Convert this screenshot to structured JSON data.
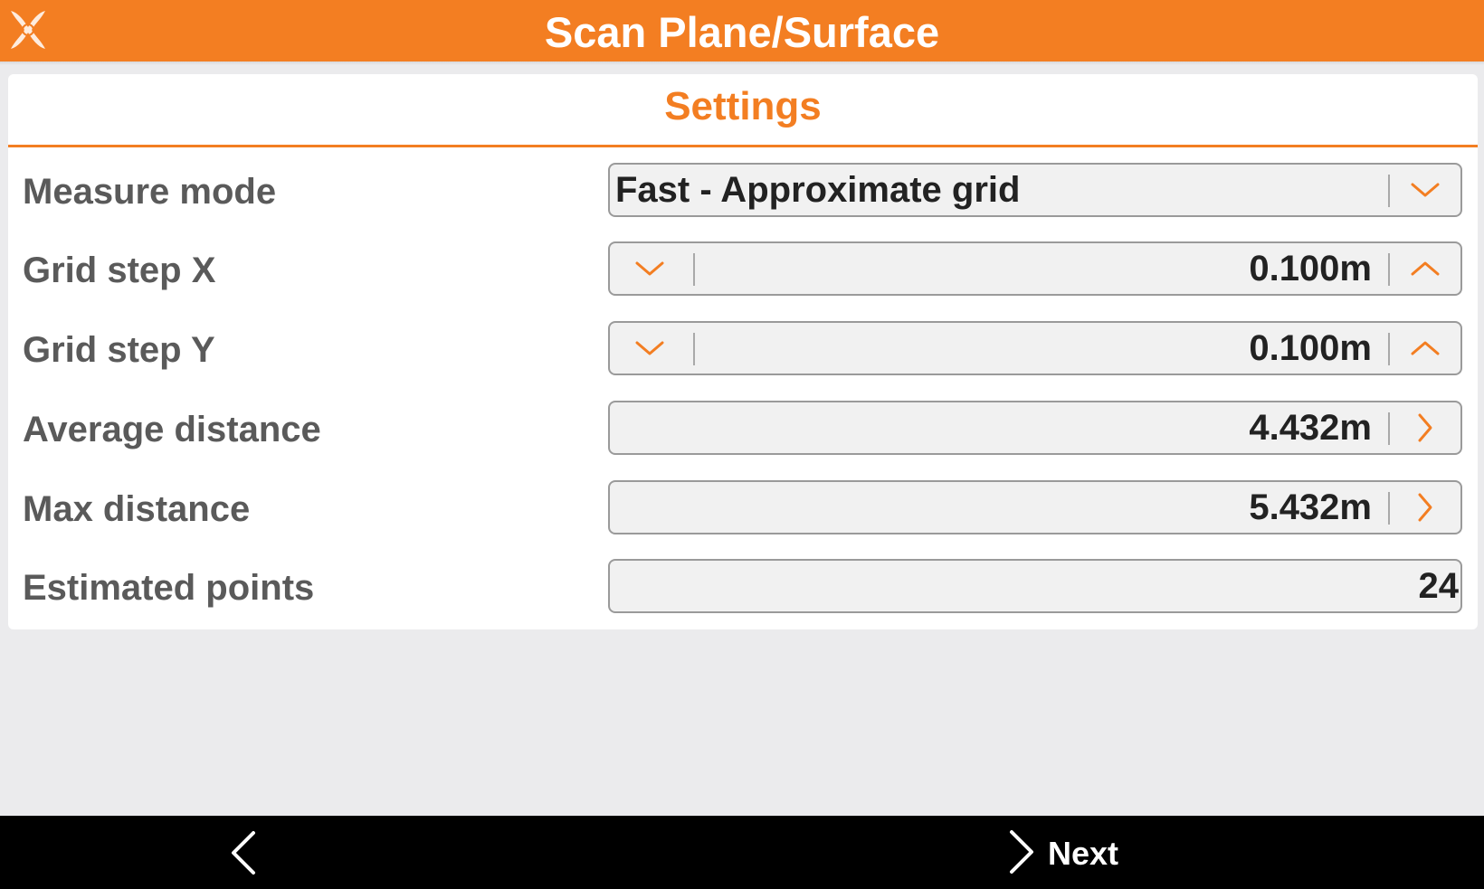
{
  "header": {
    "title": "Scan Plane/Surface",
    "logo_icon": "app-logo-icon",
    "accent_color": "#f37e22"
  },
  "panel": {
    "title": "Settings",
    "rows": [
      {
        "label": "Measure mode",
        "value": "Fast - Approximate grid",
        "control": "dropdown"
      },
      {
        "label": "Grid step X",
        "value": "0.100m",
        "control": "stepper"
      },
      {
        "label": "Grid step Y",
        "value": "0.100m",
        "control": "stepper"
      },
      {
        "label": "Average distance",
        "value": "4.432m",
        "control": "measure-arrow"
      },
      {
        "label": "Max distance",
        "value": "5.432m",
        "control": "measure-arrow"
      },
      {
        "label": "Estimated points",
        "value": "24",
        "control": "readonly"
      }
    ]
  },
  "footer": {
    "back_icon": "chevron-left-icon",
    "next_icon": "chevron-right-icon",
    "next_label": "Next"
  }
}
